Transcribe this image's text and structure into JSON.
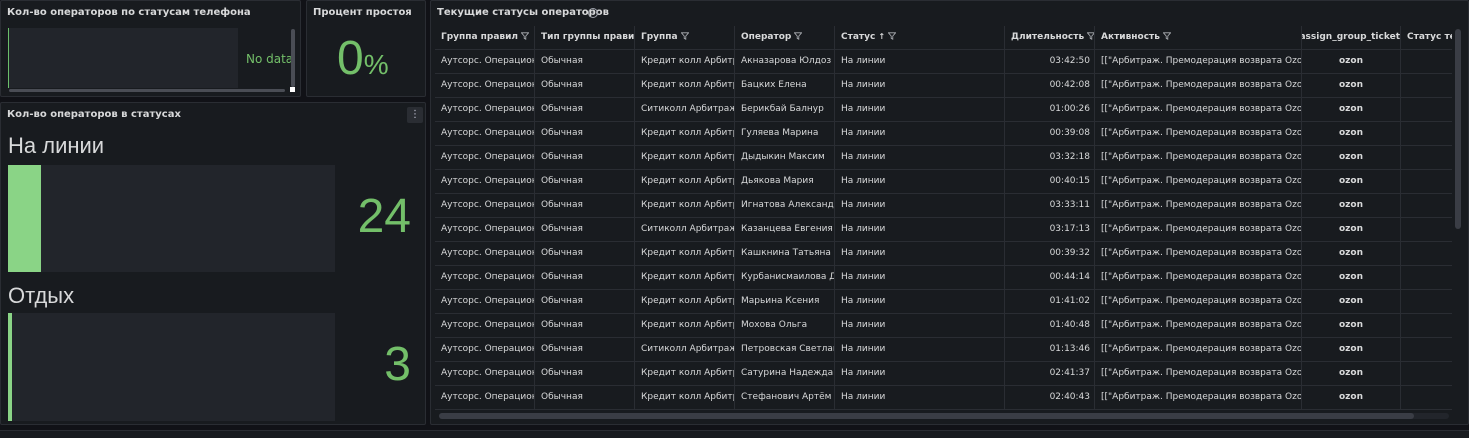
{
  "panels": {
    "phone_status": {
      "title": "Кол-во операторов по статусам телефона",
      "no_data": "No data"
    },
    "idle_percent": {
      "title": "Процент простоя",
      "value": "0",
      "unit": "%"
    },
    "statuses": {
      "title": "Кол-во операторов в статусах",
      "menu_glyph": "⋮",
      "items": [
        {
          "label": "На линии",
          "value": "24",
          "fill_fraction": 0.1
        },
        {
          "label": "Отдых",
          "value": "3",
          "fill_fraction": 0.012
        }
      ]
    },
    "table": {
      "title": "Текущие статусы операторов",
      "info_glyph": "i",
      "sort_glyph": "↑",
      "columns": [
        {
          "label": "Группа правил",
          "filter": true,
          "sort": false
        },
        {
          "label": "Тип группы правил",
          "filter": true,
          "sort": false
        },
        {
          "label": "Группа",
          "filter": true,
          "sort": false
        },
        {
          "label": "Оператор",
          "filter": true,
          "sort": false
        },
        {
          "label": "Статус",
          "filter": true,
          "sort": true
        },
        {
          "label": "Длительность",
          "filter": true,
          "sort": false
        },
        {
          "label": "Активность",
          "filter": true,
          "sort": false
        },
        {
          "label": "assign_group_ticket",
          "filter": true,
          "sort": false
        },
        {
          "label": "Статус телефона",
          "filter": false,
          "sort": false
        }
      ],
      "rows": [
        [
          "Аутсорс. Операционный",
          "Обычная",
          "Кредит колл Арбитраж",
          "Акназарова Юлдоз",
          "На линии",
          "03:42:50",
          "[[\"Арбитраж. Премодерация возврата Ozon",
          "ozon",
          ""
        ],
        [
          "Аутсорс. Операционный",
          "Обычная",
          "Кредит колл Арбитраж",
          "Бацких Елена",
          "На линии",
          "00:42:08",
          "[[\"Арбитраж. Премодерация возврата Ozon",
          "ozon",
          ""
        ],
        [
          "Аутсорс. Операционный",
          "Обычная",
          "Ситиколл Арбитраж",
          "Берикбай Балнур",
          "На линии",
          "01:00:26",
          "[[\"Арбитраж. Премодерация возврата Ozon",
          "ozon",
          ""
        ],
        [
          "Аутсорс. Операционный",
          "Обычная",
          "Кредит колл Арбитраж",
          "Гуляева Марина",
          "На линии",
          "00:39:08",
          "[[\"Арбитраж. Премодерация возврата Ozon",
          "ozon",
          ""
        ],
        [
          "Аутсорс. Операционный",
          "Обычная",
          "Кредит колл Арбитраж",
          "Дыдыкин Максим",
          "На линии",
          "03:32:18",
          "[[\"Арбитраж. Премодерация возврата Ozon",
          "ozon",
          ""
        ],
        [
          "Аутсорс. Операционный",
          "Обычная",
          "Кредит колл Арбитраж",
          "Дьякова Мария",
          "На линии",
          "00:40:15",
          "[[\"Арбитраж. Премодерация возврата Ozon",
          "ozon",
          ""
        ],
        [
          "Аутсорс. Операционный",
          "Обычная",
          "Кредит колл Арбитраж",
          "Игнатова Александра",
          "На линии",
          "03:33:11",
          "[[\"Арбитраж. Премодерация возврата Ozon",
          "ozon",
          ""
        ],
        [
          "Аутсорс. Операционный",
          "Обычная",
          "Ситиколл Арбитраж",
          "Казанцева Евгения",
          "На линии",
          "03:17:13",
          "[[\"Арбитраж. Премодерация возврата Ozon",
          "ozon",
          ""
        ],
        [
          "Аутсорс. Операционный",
          "Обычная",
          "Кредит колл Арбитраж",
          "Кашкнина Татьяна",
          "На линии",
          "00:39:32",
          "[[\"Арбитраж. Премодерация возврата Ozon",
          "ozon",
          ""
        ],
        [
          "Аутсорс. Операционный",
          "Обычная",
          "Кредит колл Арбитраж",
          "Курбанисмаилова Д",
          "На линии",
          "00:44:14",
          "[[\"Арбитраж. Премодерация возврата Ozon",
          "ozon",
          ""
        ],
        [
          "Аутсорс. Операционный",
          "Обычная",
          "Кредит колл Арбитраж",
          "Марьина Ксения",
          "На линии",
          "01:41:02",
          "[[\"Арбитраж. Премодерация возврата Ozon",
          "ozon",
          ""
        ],
        [
          "Аутсорс. Операционный",
          "Обычная",
          "Кредит колл Арбитраж",
          "Мохова Ольга",
          "На линии",
          "01:40:48",
          "[[\"Арбитраж. Премодерация возврата Ozon",
          "ozon",
          ""
        ],
        [
          "Аутсорс. Операционный",
          "Обычная",
          "Ситиколл Арбитраж",
          "Петровская Светлана",
          "На линии",
          "01:13:46",
          "[[\"Арбитраж. Премодерация возврата Ozon",
          "ozon",
          ""
        ],
        [
          "Аутсорс. Операционный",
          "Обычная",
          "Кредит колл Арбитраж",
          "Сатурина Надежда",
          "На линии",
          "02:41:37",
          "[[\"Арбитраж. Премодерация возврата Ozon",
          "ozon",
          ""
        ],
        [
          "Аутсорс. Операционный",
          "Обычная",
          "Кредит колл Арбитраж",
          "Стефанович Артём",
          "На линии",
          "02:40:43",
          "[[\"Арбитраж. Премодерация возврата Ozon",
          "ozon",
          ""
        ]
      ]
    }
  },
  "colors": {
    "accent_green": "#73bf69",
    "bar_green": "#8ad486",
    "panel_bg": "#181b1f",
    "page_bg": "#111217"
  }
}
